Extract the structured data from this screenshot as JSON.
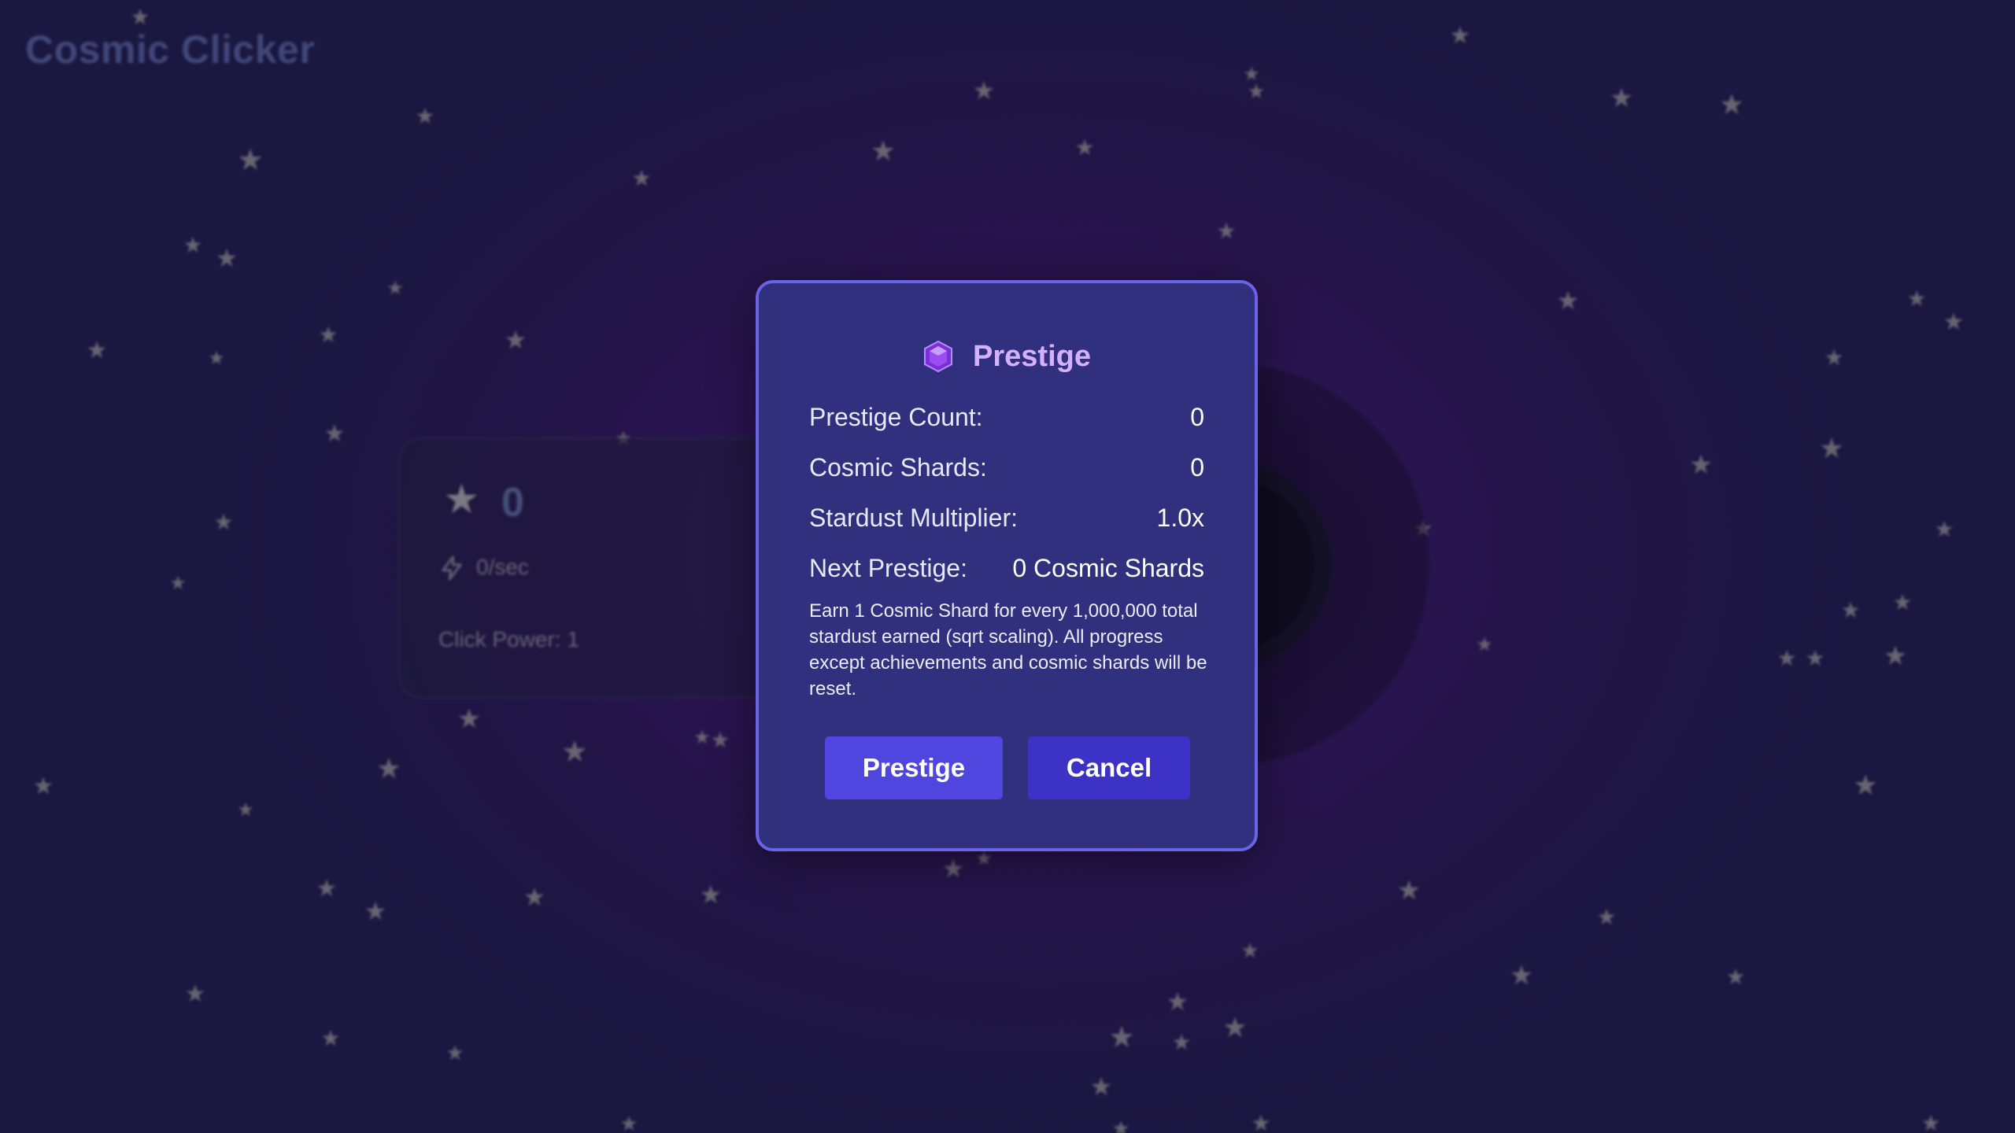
{
  "app": {
    "title": "Cosmic Clicker"
  },
  "stats": {
    "stardust": "0",
    "rate": "0/sec",
    "click_power": "Click Power: 1"
  },
  "modal": {
    "title": "Prestige",
    "rows": [
      {
        "label": "Prestige Count:",
        "value": "0"
      },
      {
        "label": "Cosmic Shards:",
        "value": "0"
      },
      {
        "label": "Stardust Multiplier:",
        "value": "1.0x"
      },
      {
        "label": "Next Prestige:",
        "value": "0 Cosmic Shards"
      }
    ],
    "description": "Earn 1 Cosmic Shard for every 1,000,000 total stardust earned (sqrt scaling). All progress except achievements and cosmic shards will be reset.",
    "confirm_label": "Prestige",
    "cancel_label": "Cancel"
  },
  "colors": {
    "modal_bg": "#31307e",
    "modal_border": "#6b63e6",
    "title_accent": "#d3b1ff",
    "primary_button": "#4f46e0",
    "secondary_button": "#3d32c6"
  },
  "icons": {
    "modal_title_icon": "gem-icon",
    "rate_icon": "lightning-icon",
    "stardust_icon": "star-icon"
  }
}
